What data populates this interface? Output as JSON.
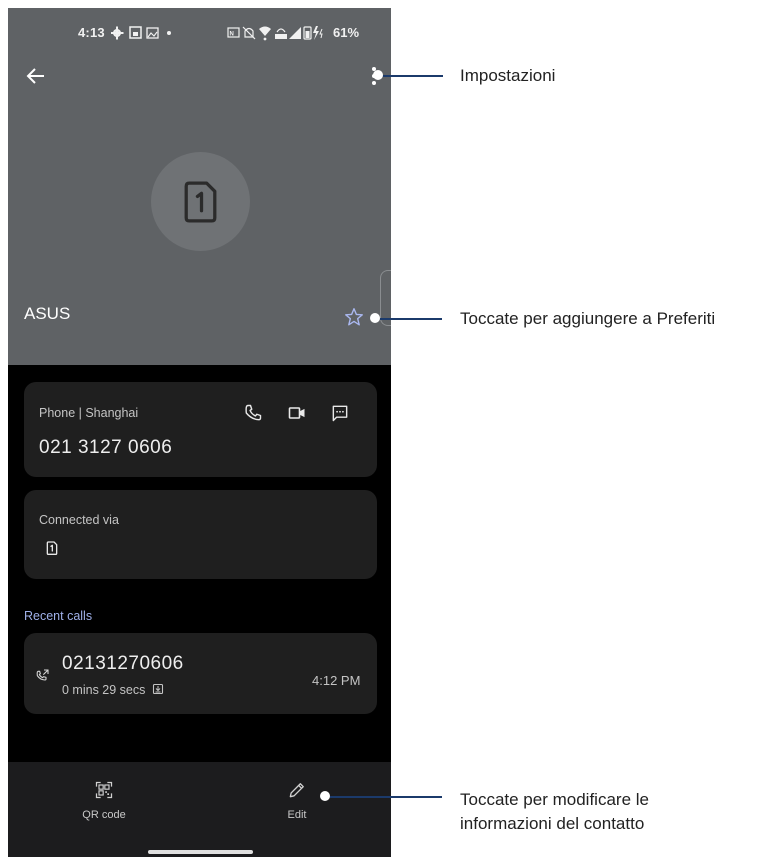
{
  "status_bar": {
    "time": "4:13",
    "battery": "61%",
    "left_icons": [
      "gear-icon",
      "save-icon",
      "image-icon",
      "dot-icon"
    ],
    "right_icons": [
      "nfc-icon",
      "mute-icon",
      "wifi-icon",
      "volte-icon",
      "signal-icon",
      "battery-charging-icon"
    ]
  },
  "contact": {
    "name": "ASUS",
    "avatar_icon": "sim-card-icon"
  },
  "phone_card": {
    "label": "Phone | Shanghai",
    "number": "021 3127 0606",
    "actions": [
      "call-icon",
      "video-call-icon",
      "message-icon"
    ]
  },
  "connected_card": {
    "label": "Connected via",
    "icon": "sim-card-icon"
  },
  "recent_calls": {
    "title": "Recent calls",
    "items": [
      {
        "number": "02131270606",
        "duration": "0 mins 29 secs",
        "time": "4:12 PM"
      }
    ]
  },
  "bottom_bar": {
    "qr_label": "QR code",
    "edit_label": "Edit"
  },
  "callouts": {
    "settings": "Impostazioni",
    "favorites": "Toccate per aggiungere a Preferiti",
    "edit_line1": "Toccate per modificare le",
    "edit_line2": "informazioni del contatto"
  },
  "colors": {
    "header_bg": "#5f6265",
    "card_bg": "#1f1f1f",
    "accent_blue": "#9fb0e8",
    "leader_line": "#1b3a6b"
  }
}
